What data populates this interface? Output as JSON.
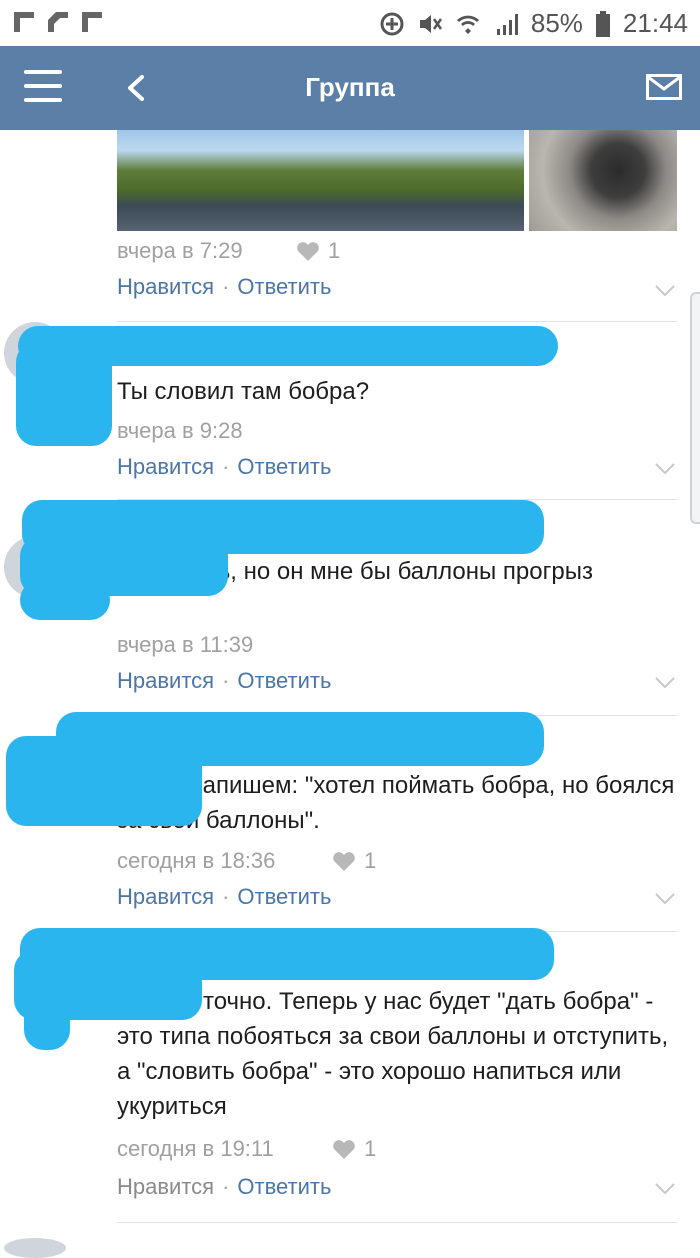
{
  "status_bar": {
    "battery": "85%",
    "time": "21:44"
  },
  "header": {
    "title": "Группа"
  },
  "comments": [
    {
      "time": "вчера в 7:29",
      "likes": "1",
      "like_label": "Нравится",
      "reply_label": "Ответить"
    },
    {
      "text": "Ты словил там бобра?",
      "time": "вчера в 9:28",
      "like_label": "Нравится",
      "reply_label": "Ответить"
    },
    {
      "text": ", хотелось, но он мне бы баллоны прогрыз",
      "time": "вчера в 11:39",
      "like_label": "Нравится",
      "reply_label": "Ответить"
    },
    {
      "text": ", так и запишем: \"хотел поймать бобра, но боялся за свои баллоны\".",
      "time": "сегодня в 18:36",
      "likes": "1",
      "like_label": "Нравится",
      "reply_label": "Ответить"
    },
    {
      "text": "точно. Теперь у нас будет \"дать бобра\" - это типа побояться за свои баллоны и отступить, а \"словить бобра\" - это хорошо напиться или укуриться",
      "time": "сегодня в 19:11",
      "likes": "1",
      "like_label": "Нравится",
      "reply_label": "Ответить"
    }
  ],
  "colors": {
    "header_bg": "#5b7fa6",
    "link": "#4a76a8",
    "scribble": "#2ab5ee"
  },
  "icons": [
    "menu-icon",
    "back-icon",
    "mail-icon",
    "heart-icon",
    "chevron-down-icon"
  ]
}
